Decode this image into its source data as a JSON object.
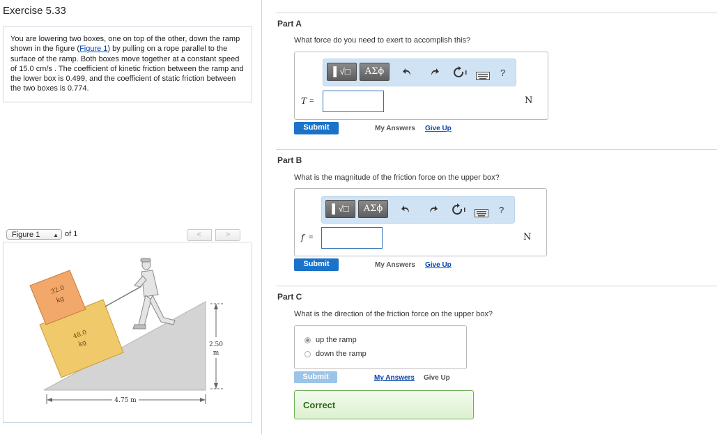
{
  "exercise": {
    "title": "Exercise 5.33",
    "problem": {
      "prefix": "You are lowering two boxes, one on top of the other, down the ramp shown in the figure (",
      "figure_link": "Figure 1",
      "suffix": ") by pulling on a rope parallel to the surface of the ramp. Both boxes move together at a constant speed of 15.0 cm/s . The coefficient of kinetic friction between the ramp and the lower box is 0.499, and the coefficient of static friction between the two boxes is 0.774."
    }
  },
  "figure_nav": {
    "selected": "Figure 1",
    "of_label": "of 1",
    "prev_glyph": "<",
    "next_glyph": ">"
  },
  "figure": {
    "upper_box_mass": "32.0",
    "upper_box_unit": "kg",
    "lower_box_mass": "48.0",
    "lower_box_unit": "kg",
    "height_value": "2.50",
    "height_unit": "m",
    "base_label": "4.75 m",
    "colors": {
      "upper_box": "#f2a86a",
      "lower_box": "#f0c96a",
      "ramp": "#d4d4d4"
    }
  },
  "toolbar": {
    "radical_label": "▌√□",
    "greek_label": "ΑΣϕ",
    "undo_icon": "undo-icon",
    "redo_icon": "redo-icon",
    "reset_icon": "reset-icon",
    "keyboard_icon": "keyboard-icon",
    "help_label": "?"
  },
  "parts": {
    "a": {
      "title": "Part A",
      "question": "What force do you need to exert to accomplish this?",
      "variable": "T",
      "equals": "=",
      "value": "",
      "unit": "N",
      "submit": "Submit",
      "my_answers": "My Answers",
      "give_up": "Give Up"
    },
    "b": {
      "title": "Part B",
      "question": "What is the magnitude of the friction force on the upper box?",
      "variable": "f",
      "equals": "=",
      "value": "",
      "unit": "N",
      "submit": "Submit",
      "my_answers": "My Answers",
      "give_up": "Give Up"
    },
    "c": {
      "title": "Part C",
      "question": "What is the direction of the friction force on the upper box?",
      "options": [
        "up the ramp",
        "down the ramp"
      ],
      "selected_index": 0,
      "submit": "Submit",
      "my_answers": "My Answers",
      "give_up": "Give Up",
      "feedback": "Correct"
    }
  },
  "colors": {
    "accent": "#1a73c9",
    "correct_border": "#70b05a",
    "link": "#0645ad"
  }
}
